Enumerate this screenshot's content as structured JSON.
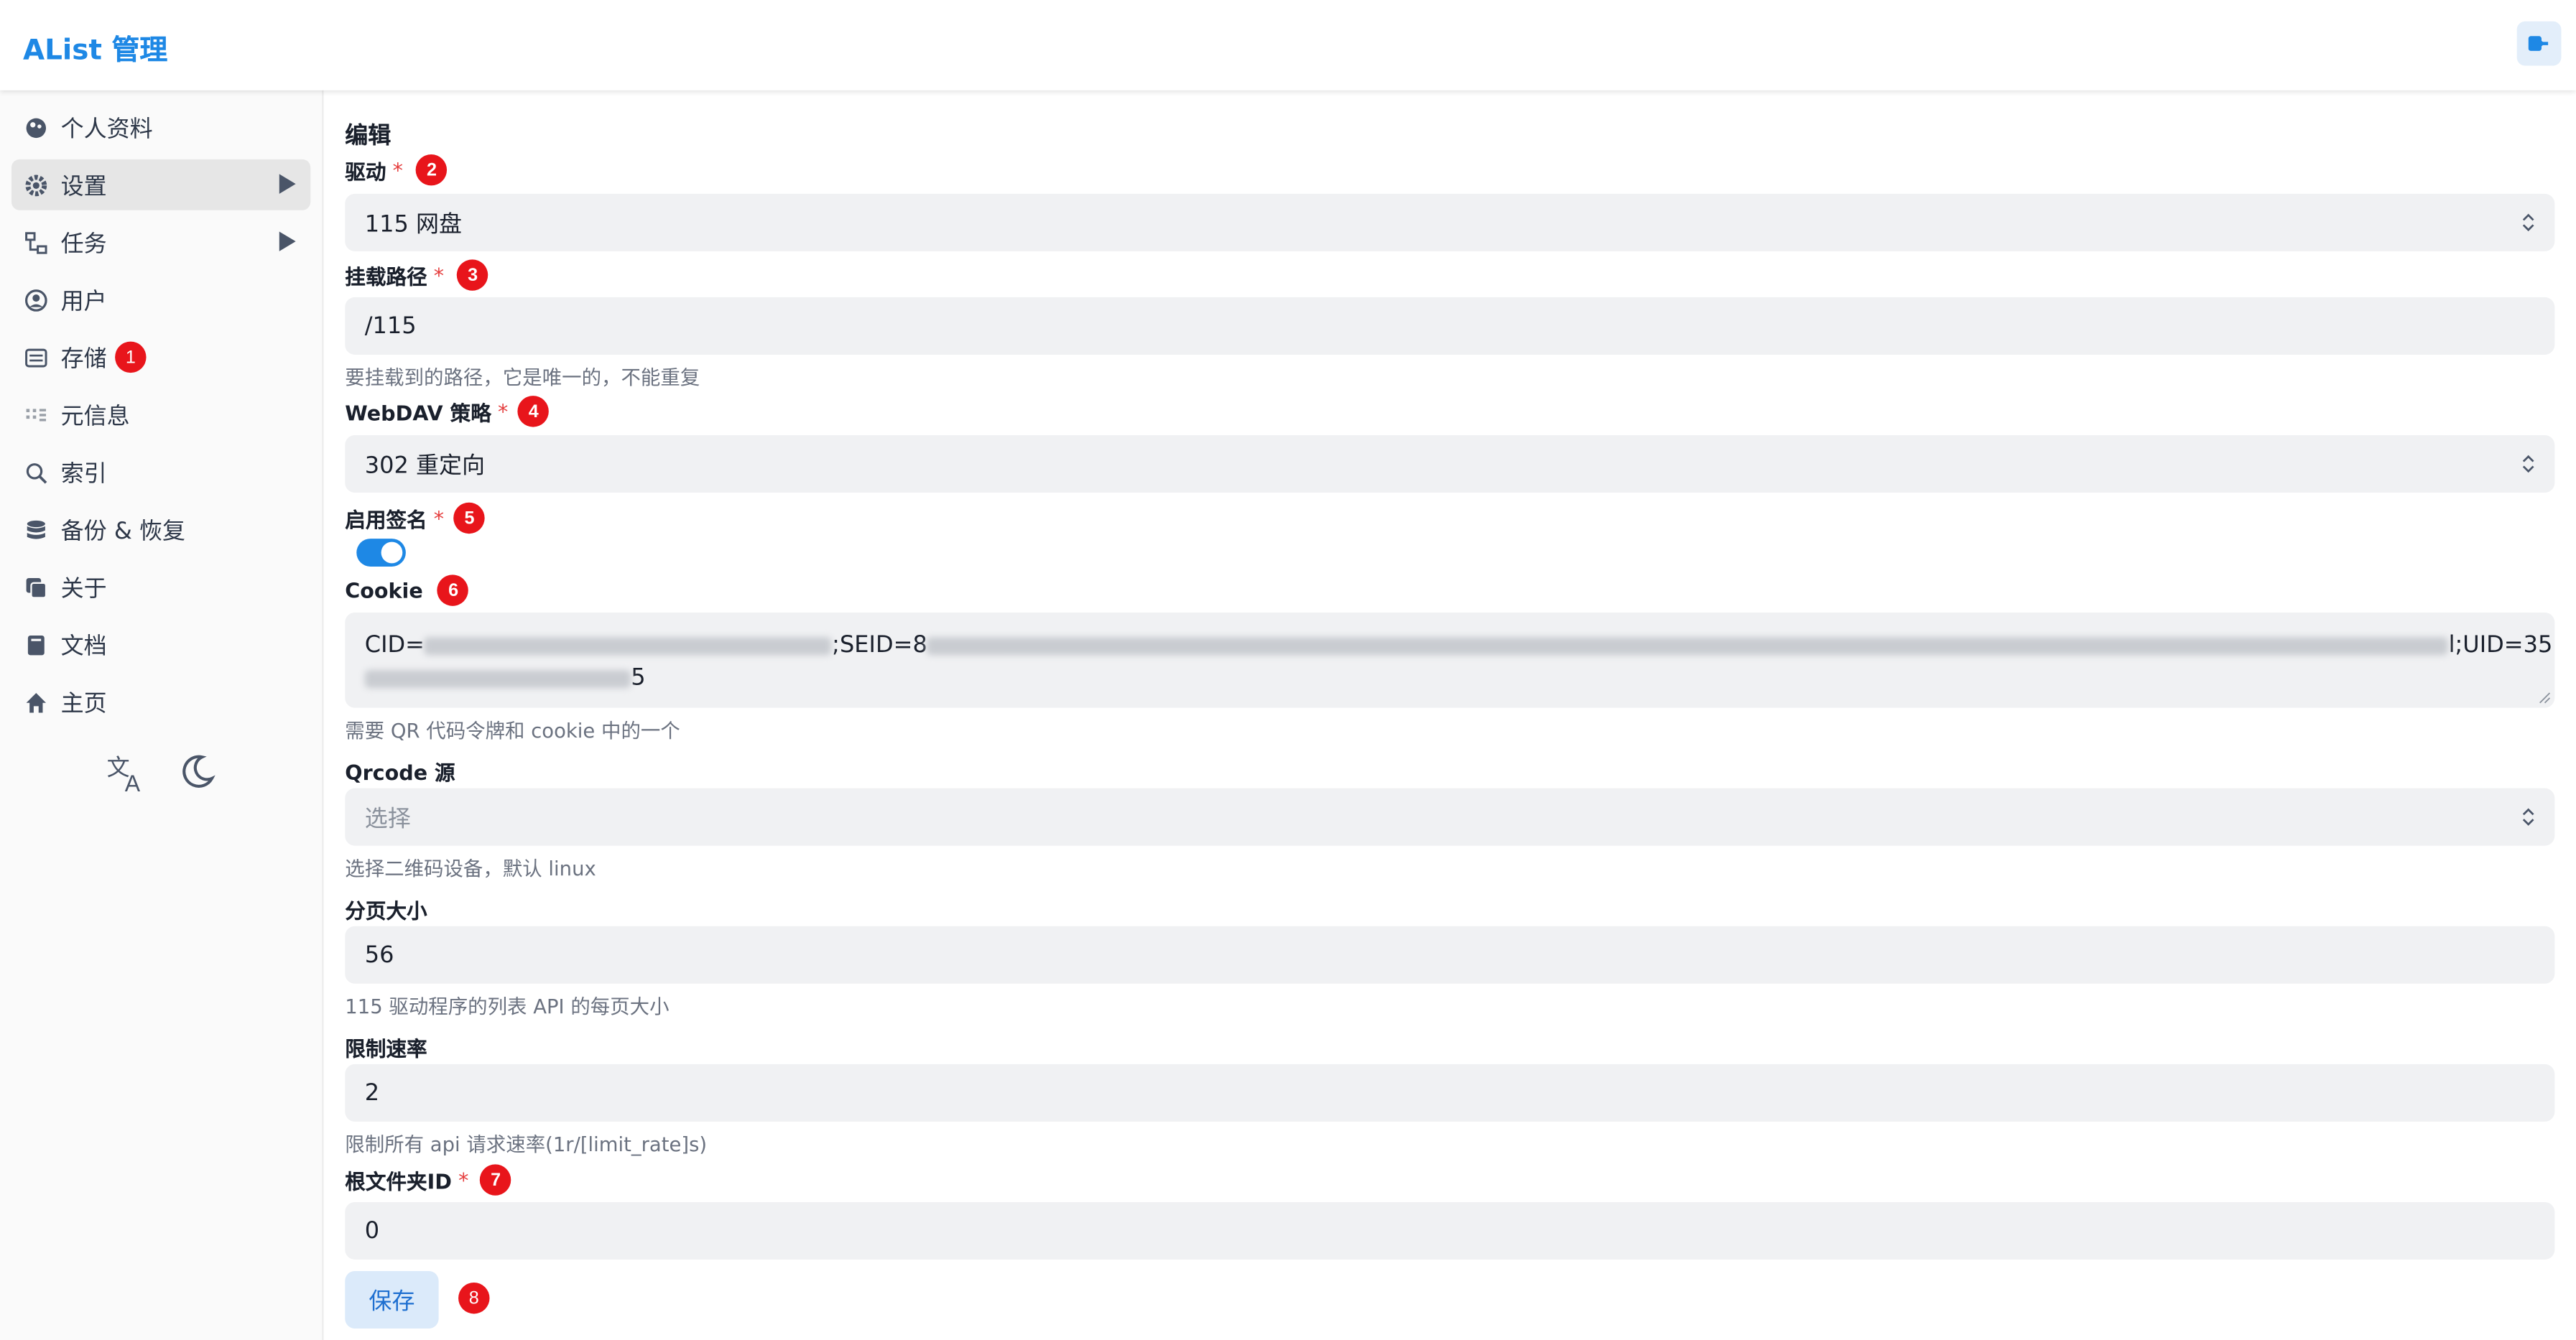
{
  "header": {
    "app_title": "AList 管理",
    "logout_icon": "logout-icon"
  },
  "sidebar": {
    "items": [
      {
        "label": "个人资料",
        "icon": "profile-icon"
      },
      {
        "label": "设置",
        "icon": "gear-icon",
        "expandable": true
      },
      {
        "label": "任务",
        "icon": "tasks-icon",
        "expandable": true
      },
      {
        "label": "用户",
        "icon": "user-circle-icon"
      },
      {
        "label": "存储",
        "icon": "storage-icon",
        "badge": "1"
      },
      {
        "label": "元信息",
        "icon": "metadata-icon"
      },
      {
        "label": "索引",
        "icon": "search-icon"
      },
      {
        "label": "备份 & 恢复",
        "icon": "database-icon"
      },
      {
        "label": "关于",
        "icon": "about-icon"
      },
      {
        "label": "文档",
        "icon": "book-icon"
      },
      {
        "label": "主页",
        "icon": "home-icon"
      }
    ],
    "tools": [
      "translate-icon",
      "moon-icon"
    ]
  },
  "form": {
    "title": "编辑",
    "driver": {
      "label": "驱动",
      "required": "*",
      "badge": "2",
      "value": "115 网盘"
    },
    "mount_path": {
      "label": "挂载路径",
      "required": "*",
      "badge": "3",
      "value": "/115",
      "help": "要挂载到的路径，它是唯一的，不能重复"
    },
    "webdav": {
      "label": "WebDAV 策略",
      "required": "*",
      "badge": "4",
      "value": "302 重定向"
    },
    "sign": {
      "label": "启用签名",
      "required": "*",
      "badge": "5",
      "enabled": true
    },
    "cookie": {
      "label": "Cookie",
      "badge": "6",
      "part1": "CID=",
      "part2": ";SEID=8",
      "part3": "l;UID=35",
      "line2_end": "5",
      "help": "需要 QR 代码令牌和 cookie 中的一个"
    },
    "qrcode": {
      "label": "Qrcode 源",
      "placeholder": "选择",
      "help": "选择二维码设备，默认 linux"
    },
    "page_size": {
      "label": "分页大小",
      "value": "56",
      "help": "115 驱动程序的列表 API 的每页大小"
    },
    "limit_rate": {
      "label": "限制速率",
      "value": "2",
      "help": "限制所有 api 请求速率(1r/[limit_rate]s)"
    },
    "root_folder": {
      "label": "根文件夹ID",
      "required": "*",
      "badge": "7",
      "value": "0"
    },
    "save": {
      "label": "保存",
      "badge": "8"
    }
  },
  "colors": {
    "accent": "#1e88e5",
    "badge": "#e8151b",
    "input_bg": "#f0f1f3"
  }
}
